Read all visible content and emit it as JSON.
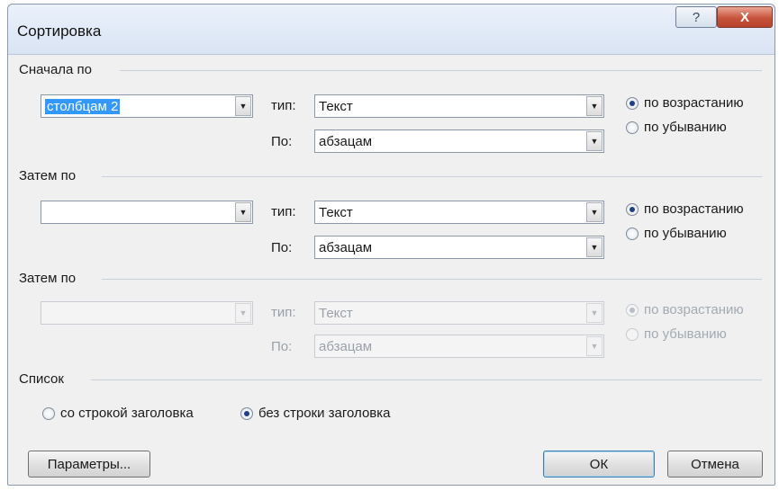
{
  "window": {
    "title": "Сортировка",
    "help_label": "?",
    "close_label": "X"
  },
  "sort1": {
    "heading": "Сначала по",
    "field_value": "столбцам 2",
    "type_label": "тип:",
    "type_value": "Текст",
    "by_label": "По:",
    "by_value": "абзацам",
    "asc_label": "по возрастанию",
    "desc_label": "по убыванию",
    "selected": "asc"
  },
  "sort2": {
    "heading": "Затем по",
    "field_value": "",
    "type_label": "тип:",
    "type_value": "Текст",
    "by_label": "По:",
    "by_value": "абзацам",
    "asc_label": "по возрастанию",
    "desc_label": "по убыванию",
    "selected": "asc"
  },
  "sort3": {
    "heading": "Затем по",
    "field_value": "",
    "type_label": "тип:",
    "type_value": "Текст",
    "by_label": "По:",
    "by_value": "абзацам",
    "asc_label": "по возрастанию",
    "desc_label": "по убыванию",
    "selected": "asc",
    "disabled": true
  },
  "list": {
    "heading": "Список",
    "with_header_label": "со строкой заголовка",
    "without_header_label": "без строки заголовка",
    "selected": "without_header"
  },
  "buttons": {
    "options_label": "Параметры...",
    "ok_label": "ОК",
    "cancel_label": "Отмена"
  },
  "colors": {
    "selection": "#3399ff",
    "close_button": "#c8533b",
    "dialog_bg": "#f0f0f0"
  }
}
